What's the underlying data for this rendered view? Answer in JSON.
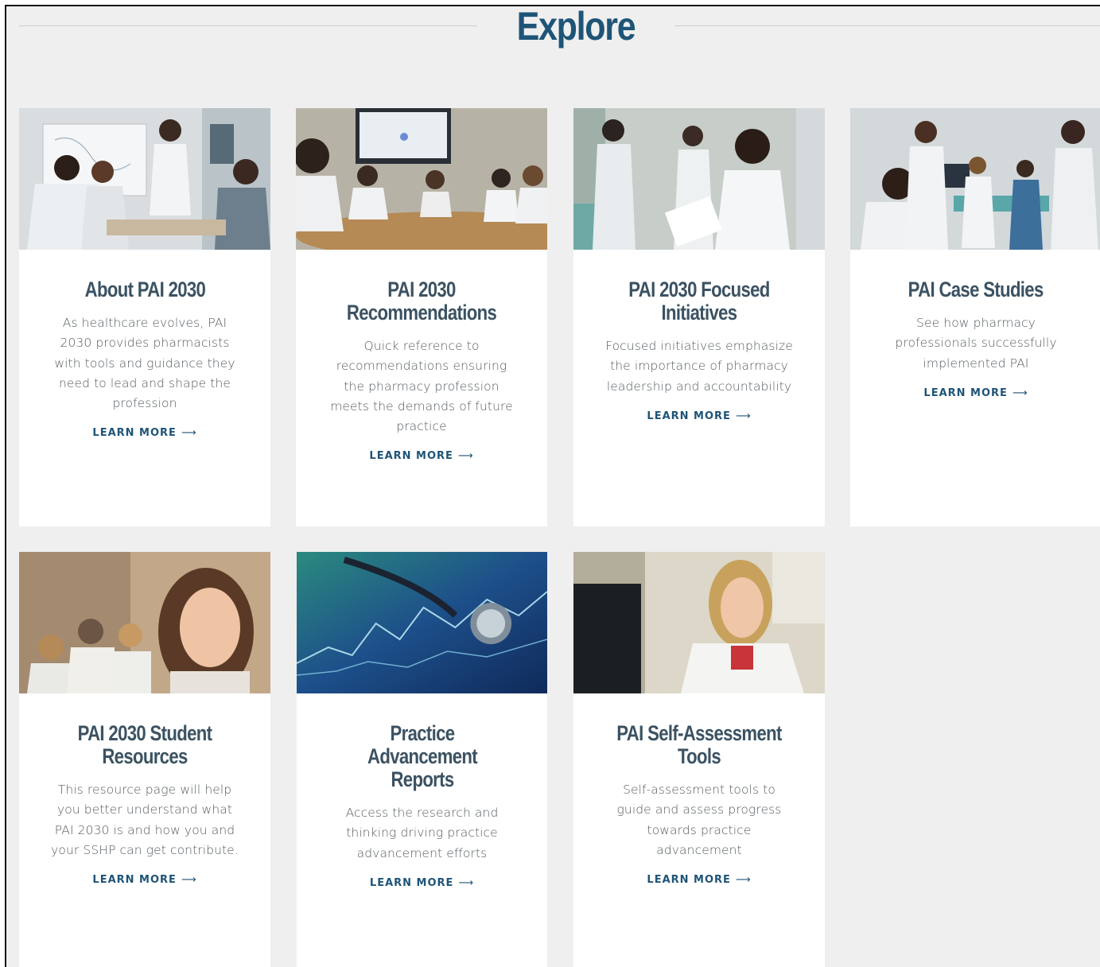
{
  "section": {
    "title": "Explore"
  },
  "colors": {
    "heading": "#1e5477",
    "card_title": "#3b5262",
    "link": "#1e5477",
    "background": "#efefef"
  },
  "cards": [
    {
      "title": "About PAI 2030",
      "description": "As healthcare evolves, PAI 2030 provides pharmacists with tools and guidance they need to lead and shape the profession",
      "link_label": "LEARN MORE",
      "link_icon": "arrow-right-icon",
      "image": "photo-pharmacist-presenting-to-group"
    },
    {
      "title": "PAI 2030 Recommendations",
      "description": "Quick reference to recommendations ensuring the pharmacy profession meets the demands of future practice",
      "link_label": "LEARN MORE",
      "link_icon": "arrow-right-icon",
      "image": "photo-conference-room-meeting"
    },
    {
      "title": "PAI 2030 Focused Initiatives",
      "description": "Focused initiatives emphasize the importance of pharmacy leadership and accountability",
      "link_label": "LEARN MORE",
      "link_icon": "arrow-right-icon",
      "image": "photo-pharmacist-holding-papers"
    },
    {
      "title": "PAI Case Studies",
      "description": "See how pharmacy professionals successfully implemented PAI",
      "link_label": "LEARN MORE",
      "link_icon": "arrow-right-icon",
      "image": "photo-clinical-team-discussion"
    },
    {
      "title": "PAI 2030 Student Resources",
      "description": "This resource page will help you better understand what PAI 2030 is and how you and your SSHP can get contribute.",
      "link_label": "LEARN MORE",
      "link_icon": "arrow-right-icon",
      "image": "photo-smiling-student"
    },
    {
      "title": "Practice Advancement Reports",
      "description": "Access the research and thinking driving practice advancement efforts",
      "link_label": "LEARN MORE",
      "link_icon": "arrow-right-icon",
      "image": "photo-stethoscope-on-chart"
    },
    {
      "title": "PAI Self-Assessment Tools",
      "description": "Self-assessment tools to guide and assess progress towards practice advancement",
      "link_label": "LEARN MORE",
      "link_icon": "arrow-right-icon",
      "image": "photo-pharmacist-at-computer"
    }
  ]
}
